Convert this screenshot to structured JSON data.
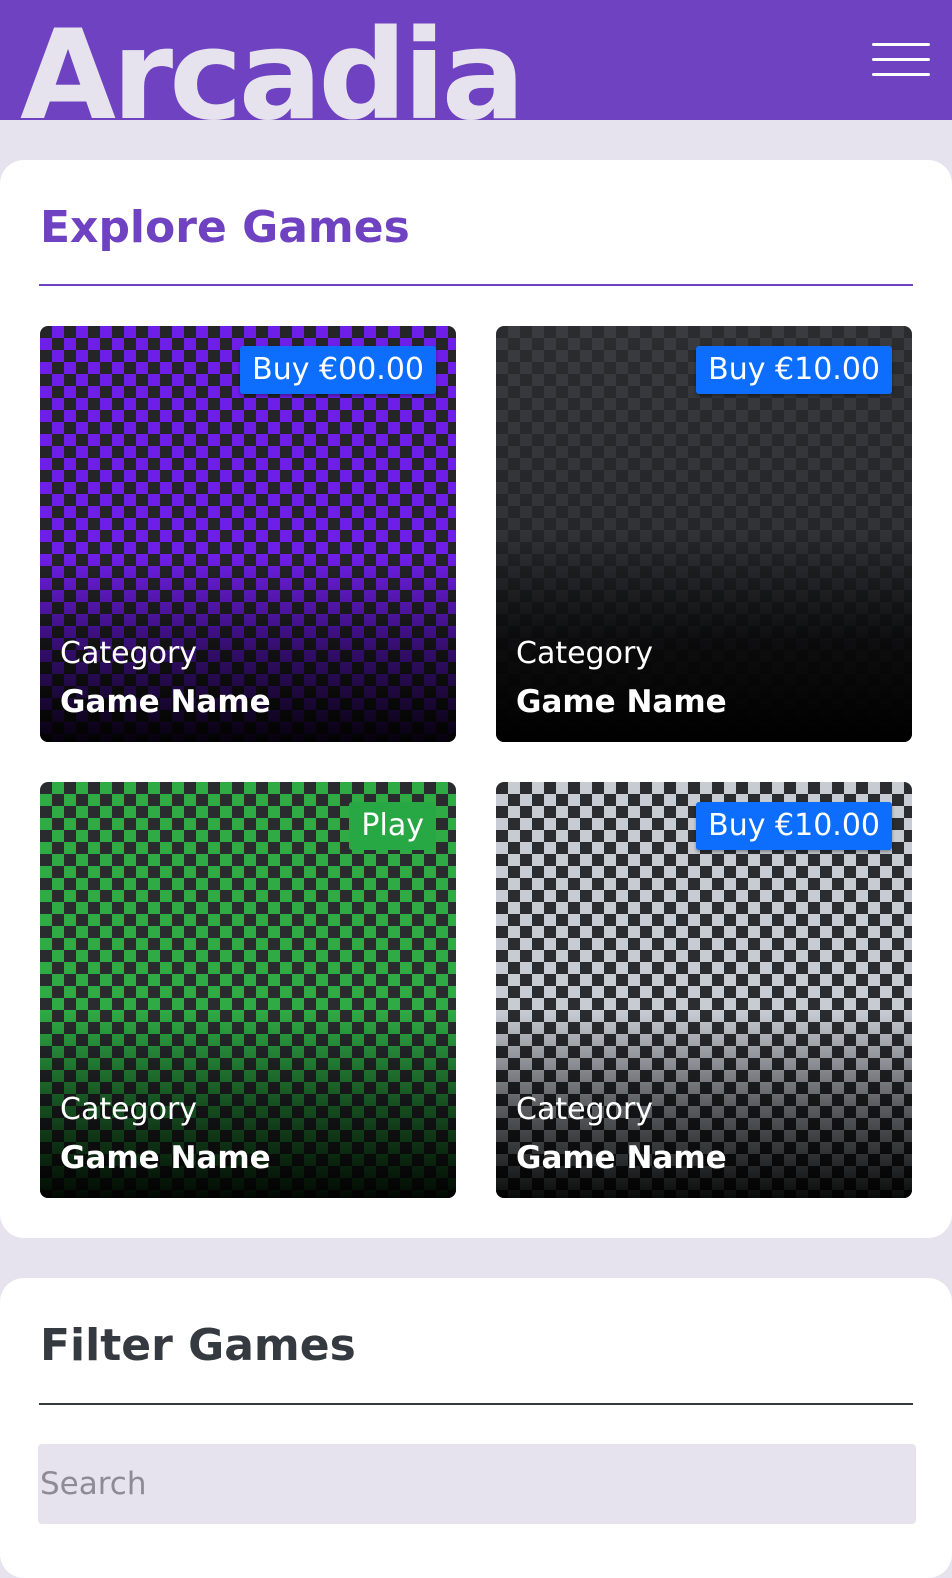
{
  "header": {
    "logo_text": "Arcadia",
    "menu_icon": "hamburger-menu-icon",
    "background_color": "#6e42c1"
  },
  "explore": {
    "title": "Explore Games",
    "title_color": "#6e42c1",
    "games": [
      {
        "badge": "Buy €00.00",
        "badge_type": "buy",
        "category": "Category",
        "name": "Game Name",
        "pattern_color": "#6f1ee8"
      },
      {
        "badge": "Buy €10.00",
        "badge_type": "buy",
        "category": "Category",
        "name": "Game Name",
        "pattern_color": "#3a3b40"
      },
      {
        "badge": "Play",
        "badge_type": "play",
        "category": "Category",
        "name": "Game Name",
        "pattern_color": "#2faa45"
      },
      {
        "badge": "Buy €10.00",
        "badge_type": "buy",
        "category": "Category",
        "name": "Game Name",
        "pattern_color": "#c7ccd3"
      }
    ]
  },
  "filter": {
    "title": "Filter Games",
    "search_placeholder": "Search",
    "search_value": ""
  },
  "colors": {
    "buy_badge": "#0d6efd",
    "play_badge": "#28a745",
    "page_background": "#e6e3ee"
  }
}
